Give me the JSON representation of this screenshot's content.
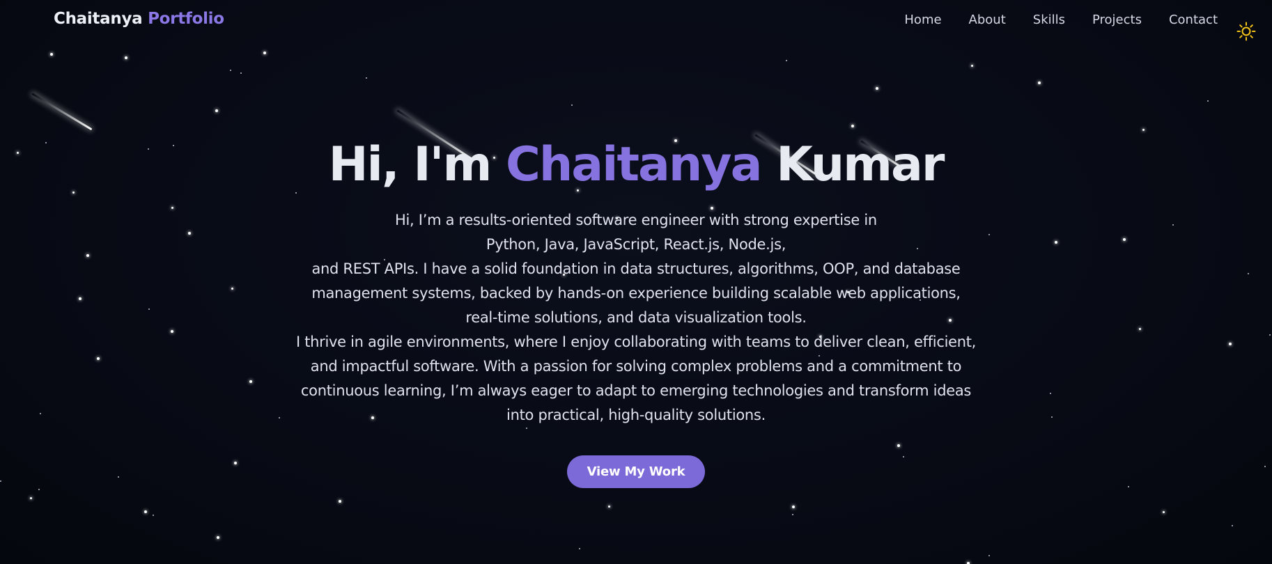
{
  "nav": {
    "brand_first": "Chaitanya",
    "brand_second": "Portfolio",
    "links": [
      "Home",
      "About",
      "Skills",
      "Projects",
      "Contact"
    ],
    "theme_icon": "sun-icon"
  },
  "hero": {
    "title_prefix": "Hi, I'm",
    "title_accent": "Chaitanya",
    "title_suffix": "Kumar",
    "description_lines": [
      "Hi, I’m a results-oriented software engineer with strong expertise in",
      "Python, Java, JavaScript, React.js, Node.js,",
      "and REST APIs. I have a solid foundation in data structures, algorithms, OOP, and database",
      "management systems, backed by hands-on experience building scalable web applications,",
      "real-time solutions, and data visualization tools.",
      "I thrive in agile environments, where I enjoy collaborating with teams to deliver clean, efficient,",
      "and impactful software. With a passion for solving complex problems and a commitment to",
      "continuous learning, I’m always eager to adapt to emerging technologies and transform ideas",
      "into practical, high-quality solutions."
    ],
    "cta_label": "View My Work"
  },
  "colors": {
    "background": "#080b14",
    "accent": "#8673e0",
    "button": "#7c6ad8",
    "sun": "#f5c518"
  }
}
